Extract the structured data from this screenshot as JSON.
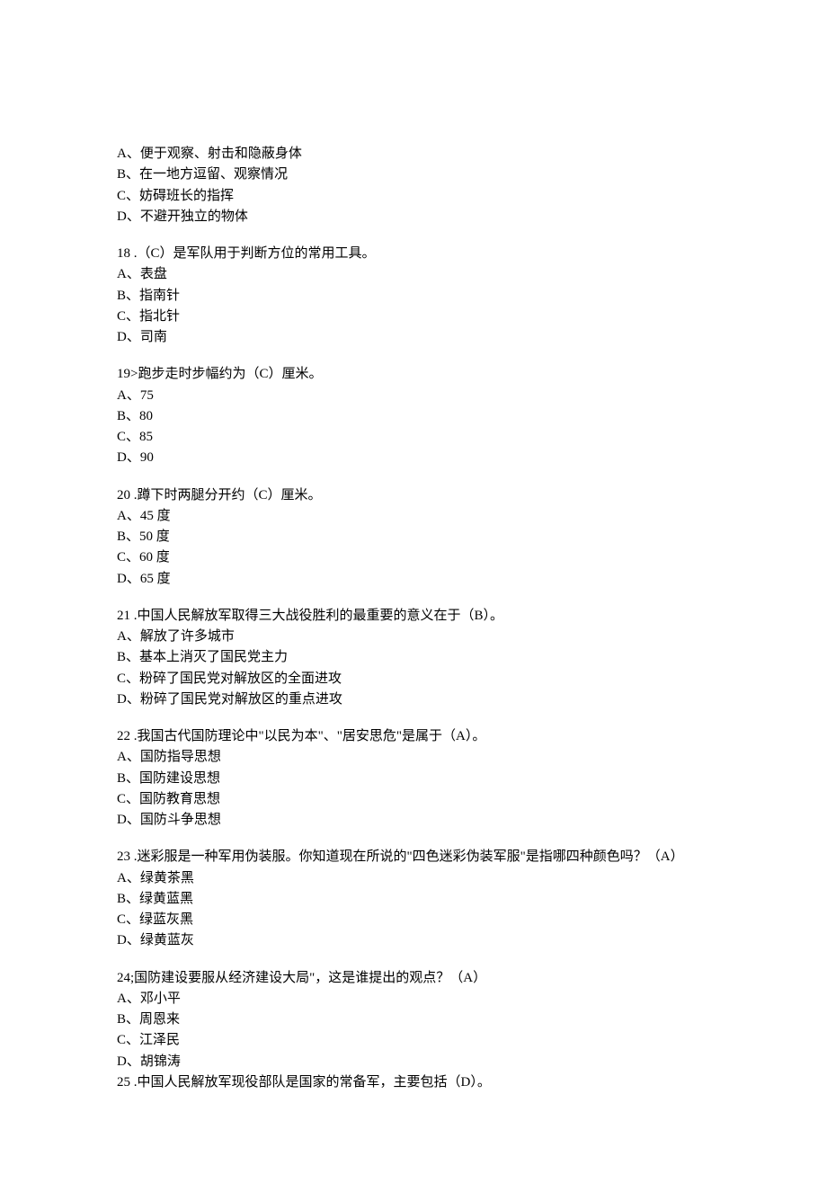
{
  "q17": {
    "optA": "A、便于观察、射击和隐蔽身体",
    "optB": "B、在一地方逗留、观察情况",
    "optC": "C、妨碍班长的指挥",
    "optD": "D、不避开独立的物体"
  },
  "q18": {
    "text": "18  .（C）是军队用于判断方位的常用工具。",
    "optA": "A、表盘",
    "optB": "B、指南针",
    "optC": "C、指北针",
    "optD": "D、司南"
  },
  "q19": {
    "text": "19>跑步走时步幅约为（C）厘米。",
    "optA": "A、75",
    "optB": "B、80",
    "optC": "C、85",
    "optD": "D、90"
  },
  "q20": {
    "text": "20  .蹲下时两腿分开约（C）厘米。",
    "optA": "A、45 度",
    "optB": "B、50 度",
    "optC": "C、60 度",
    "optD": "D、65 度"
  },
  "q21": {
    "text": "21  .中国人民解放军取得三大战役胜利的最重要的意义在于（B）。",
    "optA": "A、解放了许多城市",
    "optB": "B、基本上消灭了国民党主力",
    "optC": "C、粉碎了国民党对解放区的全面进攻",
    "optD": "D、粉碎了国民党对解放区的重点进攻"
  },
  "q22": {
    "text": "22  .我国古代国防理论中\"以民为本\"、\"居安思危\"是属于（A）。",
    "optA": "A、国防指导思想",
    "optB": "B、国防建设思想",
    "optC": "C、国防教育思想",
    "optD": "D、国防斗争思想"
  },
  "q23": {
    "text": "23  .迷彩服是一种军用伪装服。你知道现在所说的\"四色迷彩伪装军服\"是指哪四种颜色吗？（A）",
    "optA": "A、绿黄茶黑",
    "optB": "B、绿黄蓝黑",
    "optC": "C、绿蓝灰黑",
    "optD": "D、绿黄蓝灰"
  },
  "q24": {
    "text": "24;国防建设要服从经济建设大局\"，这是谁提出的观点？（A）",
    "optA": "A、邓小平",
    "optB": "B、周恩来",
    "optC": "C、江泽民",
    "optD": "D、胡锦涛"
  },
  "q25": {
    "text": "25  .中国人民解放军现役部队是国家的常备军，主要包括（D）。"
  }
}
